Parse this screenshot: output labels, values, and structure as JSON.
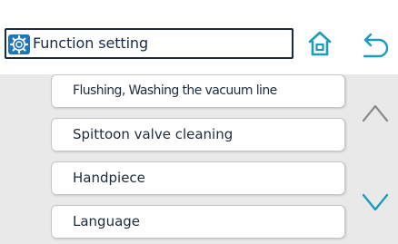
{
  "header": {
    "title": "Function setting",
    "title_icon": "gear-icon",
    "home_icon": "home-icon",
    "back_icon": "back-arrow-icon"
  },
  "menu": {
    "items": [
      {
        "label": "Flushing, Washing the vacuum line"
      },
      {
        "label": "Spittoon valve cleaning"
      },
      {
        "label": "Handpiece"
      },
      {
        "label": "Language"
      }
    ]
  },
  "scroll": {
    "up_icon": "chevron-up-icon",
    "down_icon": "chevron-down-icon"
  },
  "colors": {
    "accent": "#1d76b7",
    "navy": "#1b2a44",
    "panel_bg": "#e9e9ea"
  }
}
